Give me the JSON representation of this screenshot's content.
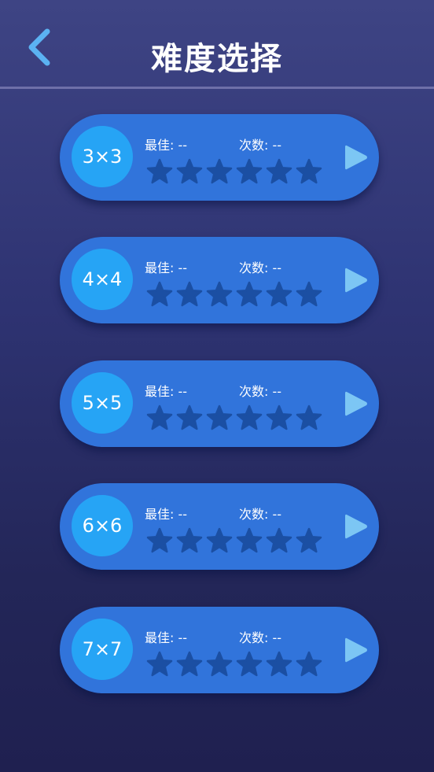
{
  "header": {
    "title": "难度选择"
  },
  "icons": {
    "back": "chevron-left-icon",
    "play": "play-icon",
    "star": "star-icon"
  },
  "colors": {
    "accent": "#3174db",
    "circle": "#26a4f5",
    "star_empty": "#1b4fa3",
    "play": "#7cc6f4",
    "back": "#5bb2f2"
  },
  "levels": [
    {
      "size": "3×3",
      "best_label": "最佳:",
      "best_value": "--",
      "count_label": "次数:",
      "count_value": "--",
      "stars_filled": 0,
      "stars_total": 6
    },
    {
      "size": "4×4",
      "best_label": "最佳:",
      "best_value": "--",
      "count_label": "次数:",
      "count_value": "--",
      "stars_filled": 0,
      "stars_total": 6
    },
    {
      "size": "5×5",
      "best_label": "最佳:",
      "best_value": "--",
      "count_label": "次数:",
      "count_value": "--",
      "stars_filled": 0,
      "stars_total": 6
    },
    {
      "size": "6×6",
      "best_label": "最佳:",
      "best_value": "--",
      "count_label": "次数:",
      "count_value": "--",
      "stars_filled": 0,
      "stars_total": 6
    },
    {
      "size": "7×7",
      "best_label": "最佳:",
      "best_value": "--",
      "count_label": "次数:",
      "count_value": "--",
      "stars_filled": 0,
      "stars_total": 6
    }
  ]
}
